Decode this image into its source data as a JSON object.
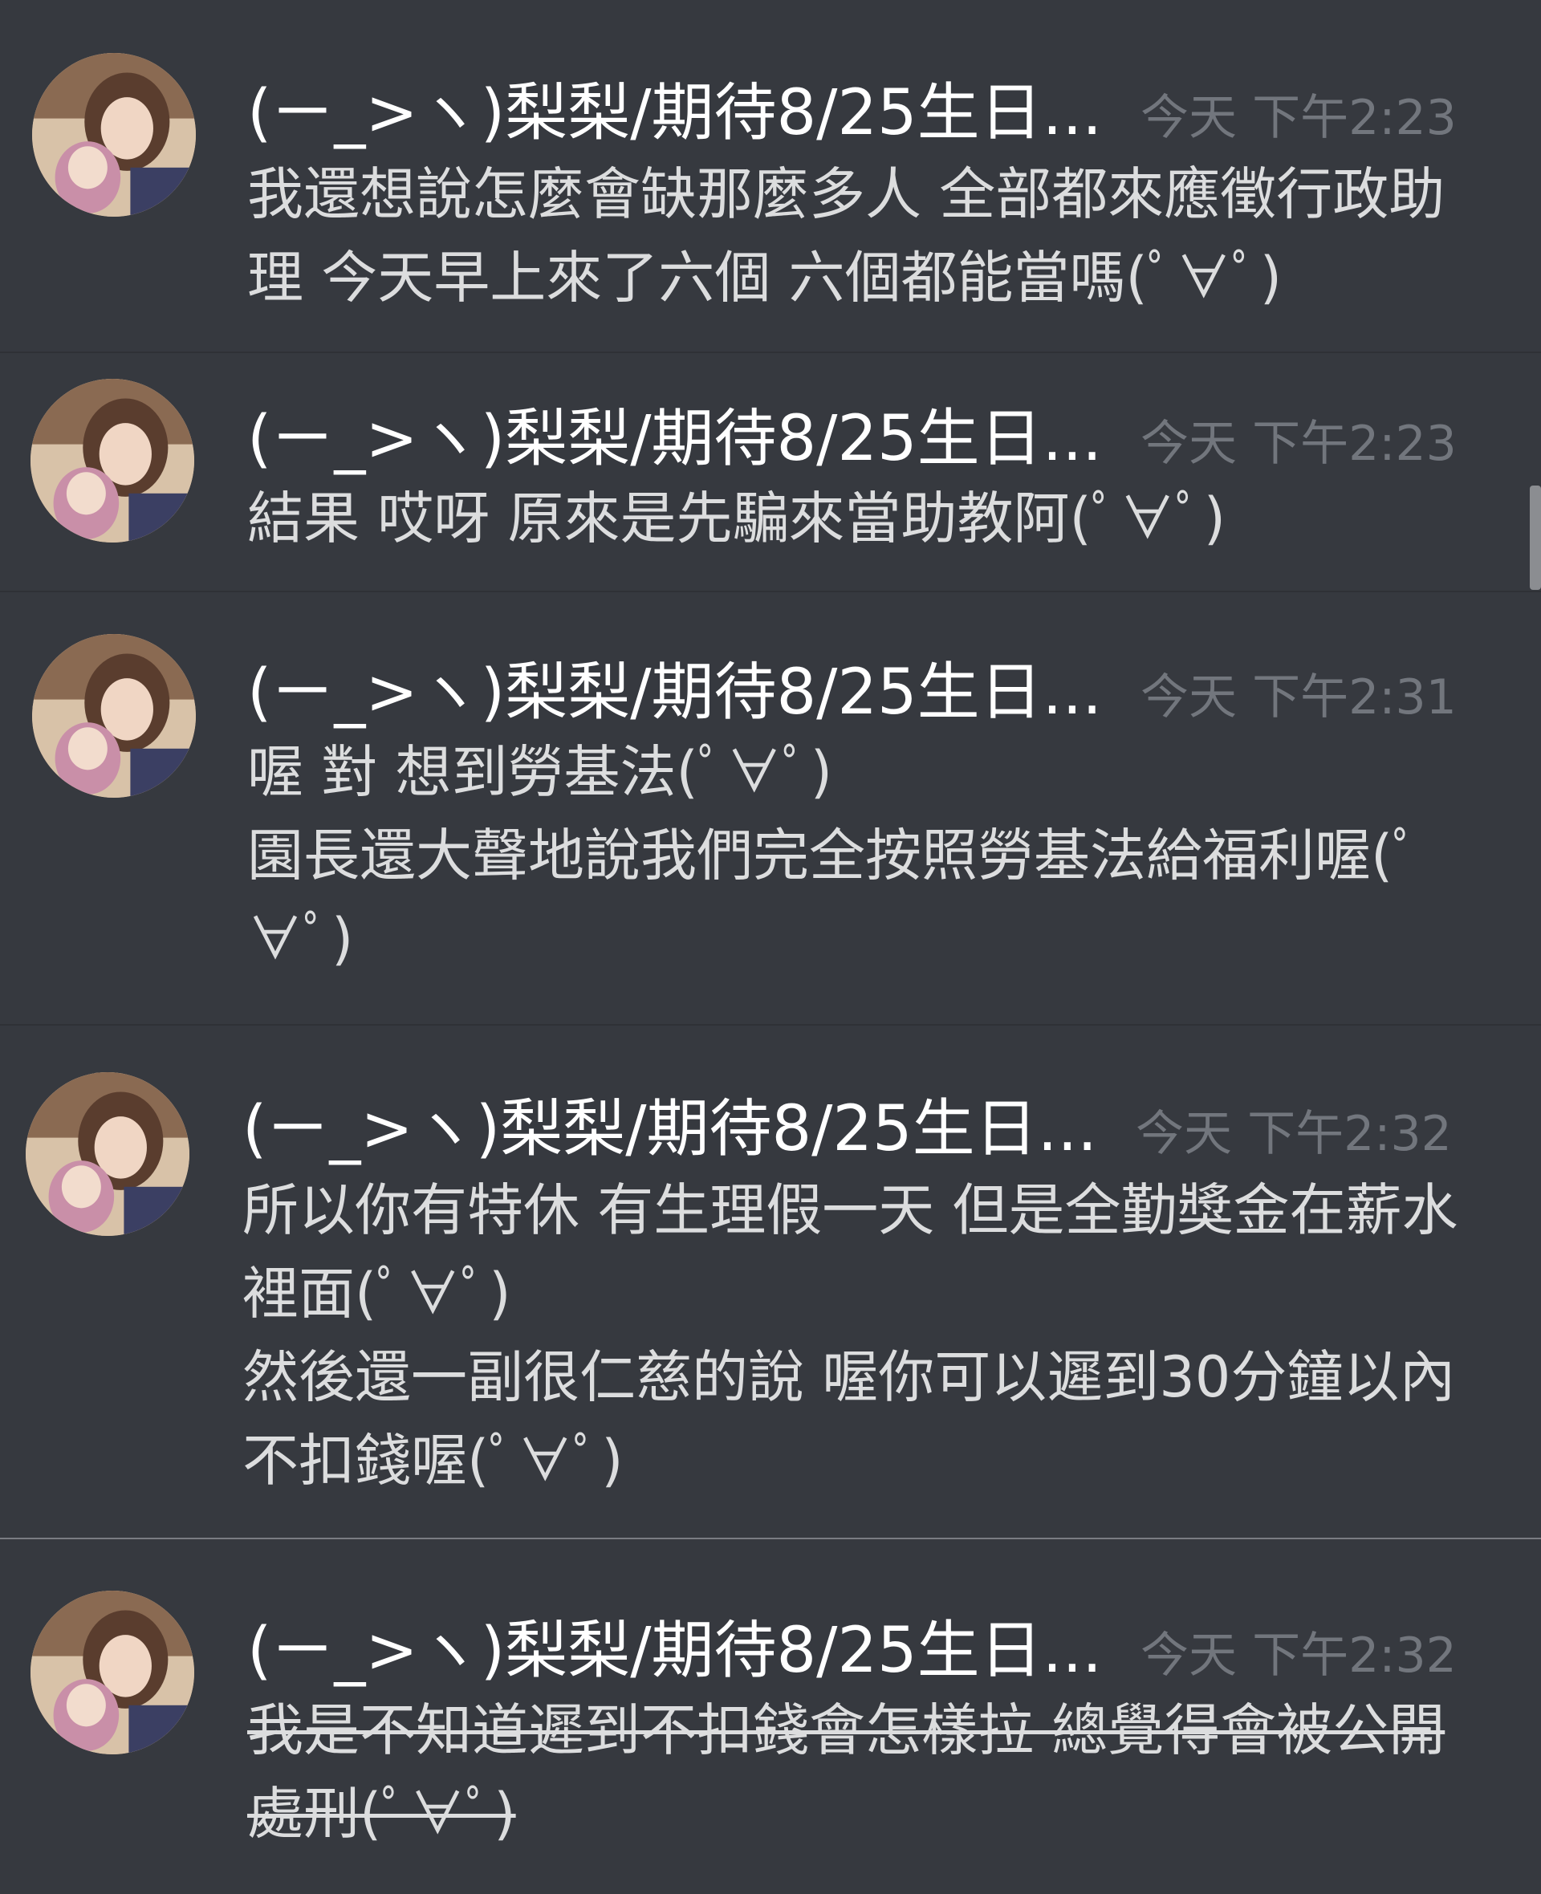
{
  "messages": [
    {
      "username": "(ㄧ_>ヽ)梨梨/期待8/25生日...",
      "timestamp": "今天 下午2:23",
      "lines": [
        "我還想說怎麼會缺那麼多人 全部都來應徵行政助理 今天早上來了六個 六個都能當嗎(ﾟ∀ﾟ)"
      ]
    },
    {
      "username": "(ㄧ_>ヽ)梨梨/期待8/25生日...",
      "timestamp": "今天 下午2:23",
      "lines": [
        "結果 哎呀 原來是先騙來當助教阿(ﾟ∀ﾟ)"
      ]
    },
    {
      "username": "(ㄧ_>ヽ)梨梨/期待8/25生日...",
      "timestamp": "今天 下午2:31",
      "lines": [
        "喔 對 想到勞基法(ﾟ∀ﾟ)",
        "園長還大聲地說我們完全按照勞基法給福利喔(ﾟ∀ﾟ)"
      ]
    },
    {
      "username": "(ㄧ_>ヽ)梨梨/期待8/25生日...",
      "timestamp": "今天 下午2:32",
      "lines": [
        "所以你有特休 有生理假一天 但是全勤獎金在薪水裡面(ﾟ∀ﾟ)",
        "然後還一副很仁慈的說 喔你可以遲到30分鐘以內不扣錢喔(ﾟ∀ﾟ)"
      ]
    },
    {
      "username": "(ㄧ_>ヽ)梨梨/期待8/25生日...",
      "timestamp": "今天 下午2:32",
      "lines": [
        "我是不知道遲到不扣錢會怎樣拉 總覺得會被公開處刑(ﾟ∀ﾟ)"
      ]
    }
  ]
}
